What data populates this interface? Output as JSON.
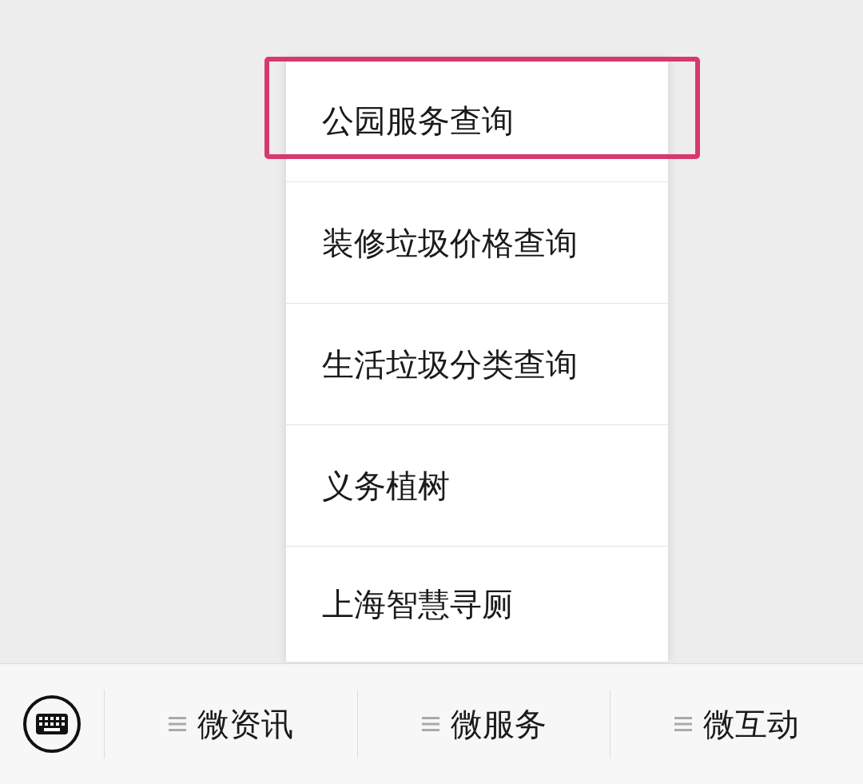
{
  "menu_popup": {
    "items": [
      {
        "label": "公园服务查询",
        "highlighted": true
      },
      {
        "label": "装修垃圾价格查询",
        "highlighted": false
      },
      {
        "label": "生活垃圾分类查询",
        "highlighted": false
      },
      {
        "label": "义务植树",
        "highlighted": false
      },
      {
        "label": "上海智慧寻厕",
        "highlighted": false
      }
    ]
  },
  "bottom_bar": {
    "menus": [
      {
        "label": "微资讯"
      },
      {
        "label": "微服务"
      },
      {
        "label": "微互动"
      }
    ]
  }
}
